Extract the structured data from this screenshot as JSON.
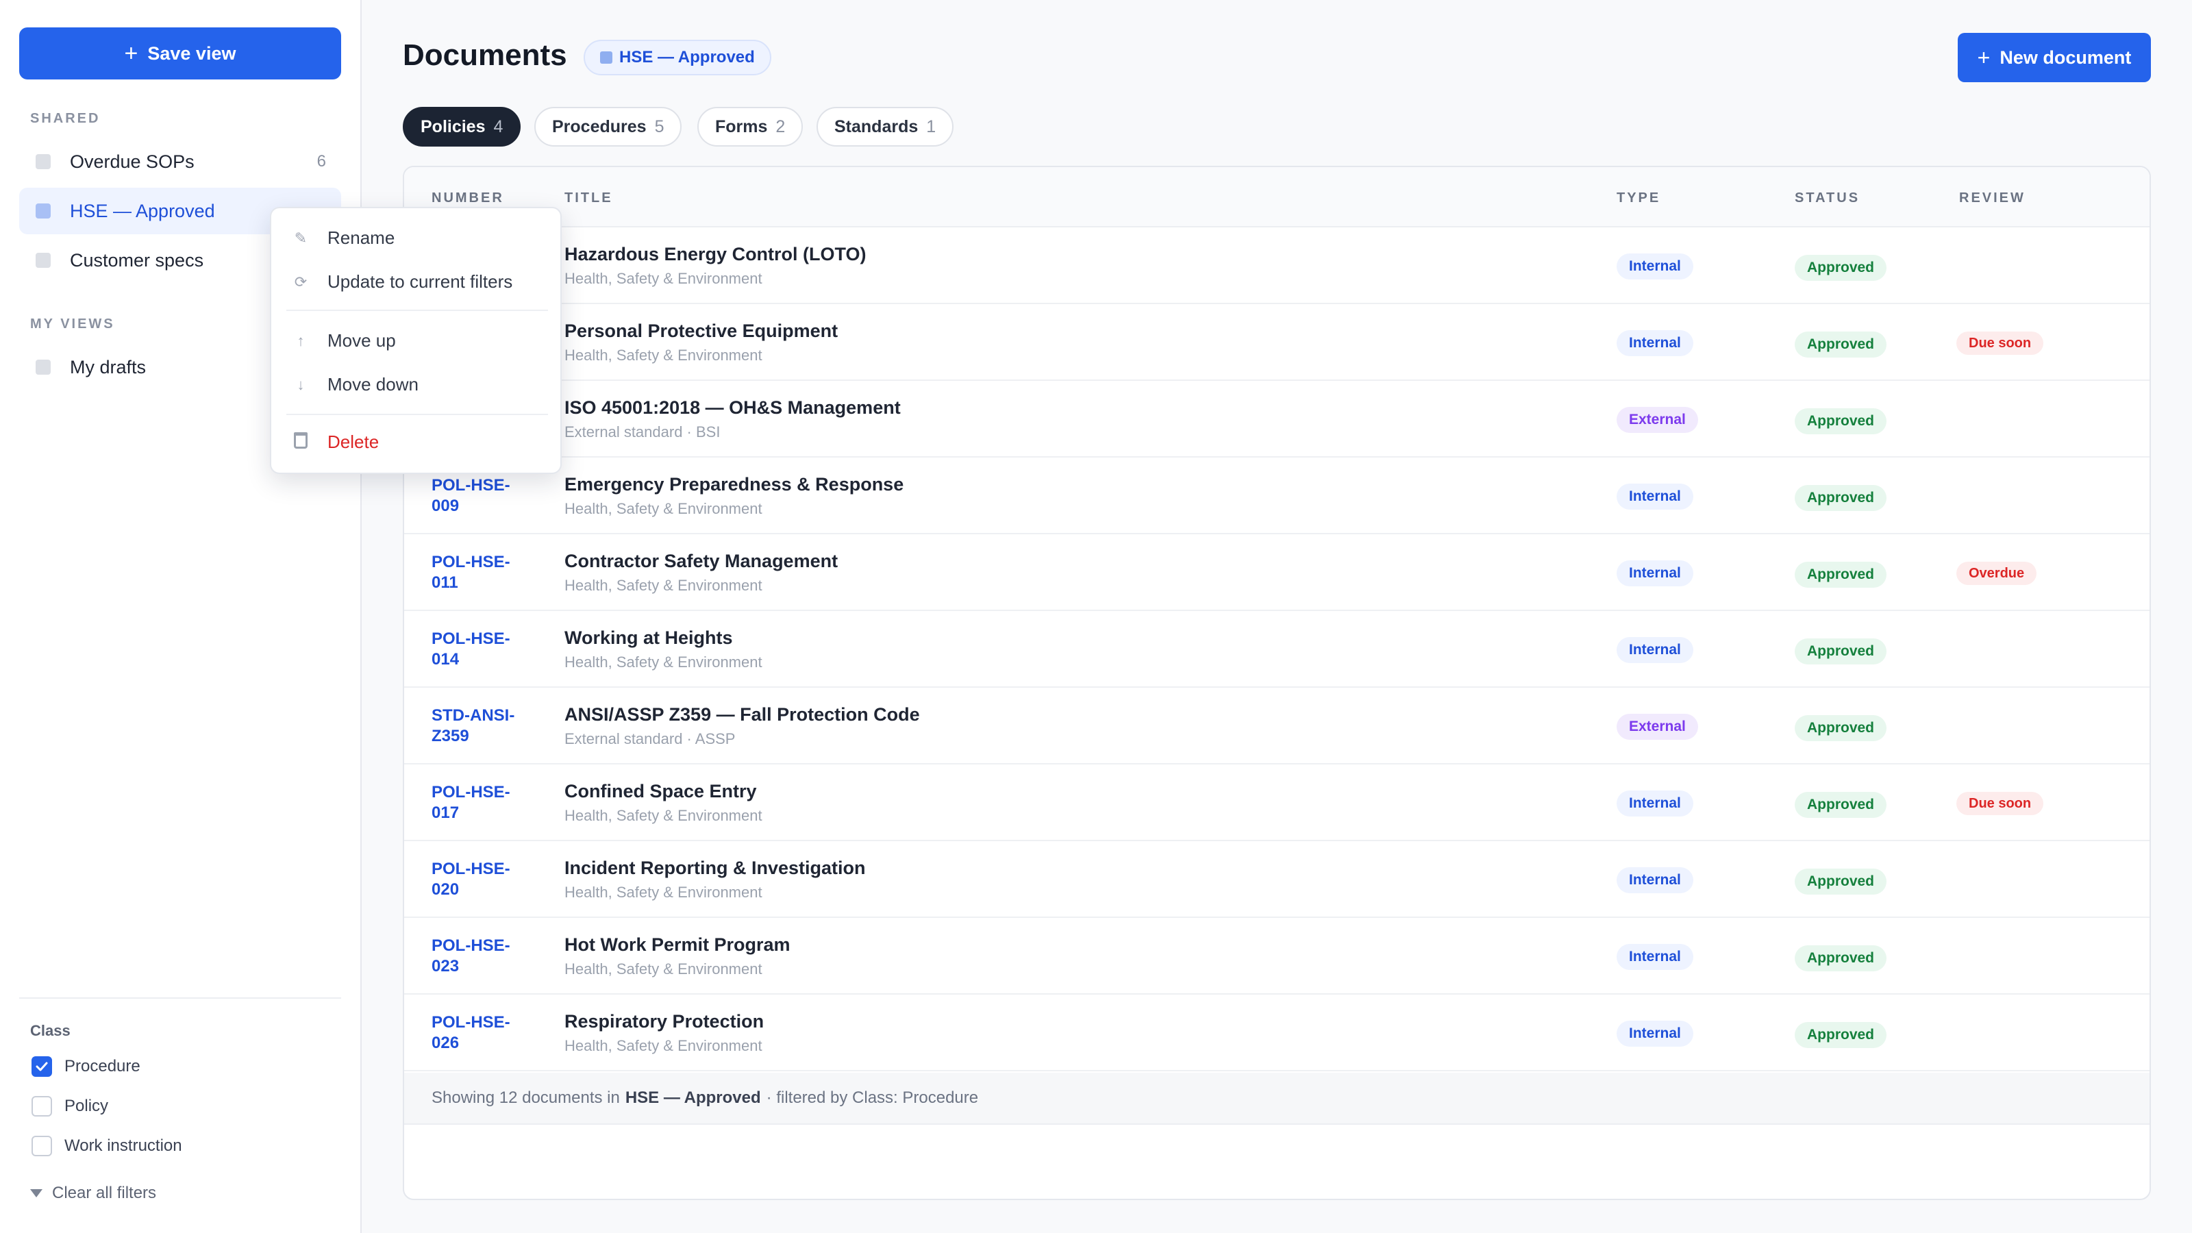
{
  "sidebar": {
    "save_view_label": "Save view",
    "shared_label": "SHARED",
    "my_views_label": "MY VIEWS",
    "shared_views": [
      {
        "label": "Overdue SOPs",
        "count": "6"
      },
      {
        "label": "HSE — Approved",
        "count": ""
      },
      {
        "label": "Customer specs",
        "count": ""
      }
    ],
    "my_views": [
      {
        "label": "My drafts"
      }
    ],
    "filters": {
      "title": "Class",
      "options": [
        {
          "label": "Procedure",
          "checked": true
        },
        {
          "label": "Policy",
          "checked": false
        },
        {
          "label": "Work instruction",
          "checked": false
        }
      ],
      "clear_label": "Clear all filters"
    }
  },
  "context_menu": {
    "items": [
      {
        "label": "Rename",
        "icon": "pencil-icon"
      },
      {
        "label": "Update to current filters",
        "icon": "refresh-icon"
      },
      {
        "label": "Move up",
        "icon": "arrow-up-icon"
      },
      {
        "label": "Move down",
        "icon": "arrow-down-icon"
      },
      {
        "label": "Delete",
        "icon": "trash-icon"
      }
    ]
  },
  "header": {
    "title": "Documents",
    "view_chip": "HSE — Approved",
    "new_document_label": "New document"
  },
  "tabs": [
    {
      "label": "Policies",
      "count": "4"
    },
    {
      "label": "Procedures",
      "count": "5"
    },
    {
      "label": "Forms",
      "count": "2"
    },
    {
      "label": "Standards",
      "count": "1"
    }
  ],
  "table": {
    "columns": [
      "NUMBER",
      "TITLE",
      "TYPE",
      "STATUS",
      "REVIEW"
    ],
    "rows": [
      {
        "number": "",
        "title": "Hazardous Energy Control (LOTO)",
        "subtitle": "Health, Safety & Environment",
        "type": "Internal",
        "status": "Approved",
        "review": ""
      },
      {
        "number": "",
        "title": "Personal Protective Equipment",
        "subtitle": "Health, Safety & Environment",
        "type": "Internal",
        "status": "Approved",
        "review": "Due soon"
      },
      {
        "number": "",
        "title": "ISO 45001:2018 — OH&S Management",
        "subtitle": "External standard · BSI",
        "type": "External",
        "status": "Approved",
        "review": ""
      },
      {
        "number": "POL-HSE-009",
        "title": "Emergency Preparedness & Response",
        "subtitle": "Health, Safety & Environment",
        "type": "Internal",
        "status": "Approved",
        "review": ""
      },
      {
        "number": "POL-HSE-011",
        "title": "Contractor Safety Management",
        "subtitle": "Health, Safety & Environment",
        "type": "Internal",
        "status": "Approved",
        "review": "Overdue"
      },
      {
        "number": "POL-HSE-014",
        "title": "Working at Heights",
        "subtitle": "Health, Safety & Environment",
        "type": "Internal",
        "status": "Approved",
        "review": ""
      },
      {
        "number": "STD-ANSI-Z359",
        "title": "ANSI/ASSP Z359 — Fall Protection Code",
        "subtitle": "External standard · ASSP",
        "type": "External",
        "status": "Approved",
        "review": ""
      },
      {
        "number": "POL-HSE-017",
        "title": "Confined Space Entry",
        "subtitle": "Health, Safety & Environment",
        "type": "Internal",
        "status": "Approved",
        "review": "Due soon"
      },
      {
        "number": "POL-HSE-020",
        "title": "Incident Reporting & Investigation",
        "subtitle": "Health, Safety & Environment",
        "type": "Internal",
        "status": "Approved",
        "review": ""
      },
      {
        "number": "POL-HSE-023",
        "title": "Hot Work Permit Program",
        "subtitle": "Health, Safety & Environment",
        "type": "Internal",
        "status": "Approved",
        "review": ""
      },
      {
        "number": "POL-HSE-026",
        "title": "Respiratory Protection",
        "subtitle": "Health, Safety & Environment",
        "type": "Internal",
        "status": "Approved",
        "review": ""
      }
    ],
    "footer": {
      "prefix": "Showing 12 documents in",
      "view_name": "HSE — Approved",
      "suffix": "· filtered by Class: Procedure"
    }
  },
  "colors": {
    "accent": "#2563eb",
    "approved": "#15803d",
    "overdue": "#dc2626",
    "external": "#7c3aed"
  }
}
